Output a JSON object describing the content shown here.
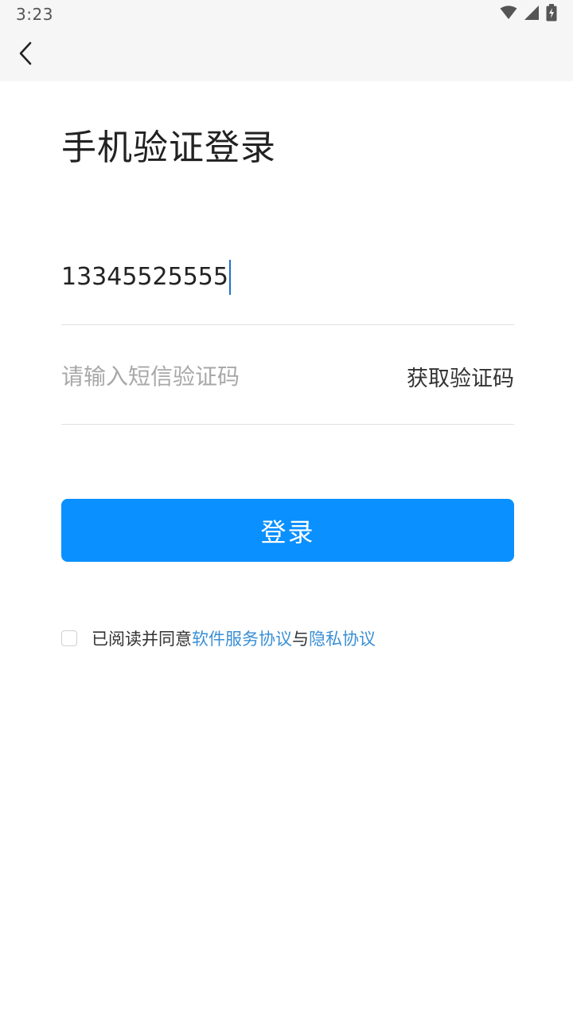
{
  "status_bar": {
    "time": "3:23",
    "icons": [
      "wifi-icon",
      "signal-icon",
      "battery-charging-icon"
    ]
  },
  "nav": {
    "back_icon": "chevron-left-icon"
  },
  "page": {
    "title": "手机验证登录"
  },
  "form": {
    "phone_value": "13345525555",
    "code_placeholder": "请输入短信验证码",
    "code_value": "",
    "get_code_label": "获取验证码",
    "login_label": "登录"
  },
  "agreement": {
    "checked": false,
    "prefix": "已阅读并同意",
    "terms_link": "软件服务协议",
    "joiner": "与",
    "privacy_link": "隐私协议"
  },
  "colors": {
    "accent": "#0a90ff",
    "link": "#3a8fd6",
    "top_bar_bg": "#f6f6f6"
  }
}
